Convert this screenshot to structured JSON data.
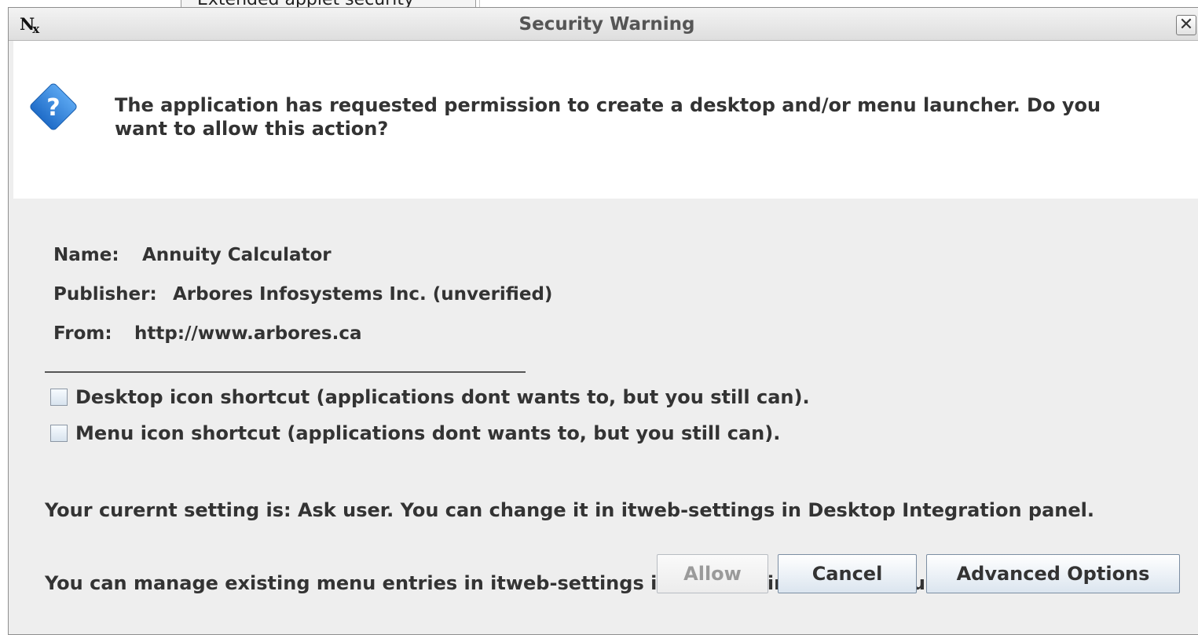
{
  "background": {
    "tab_text": "Extended applet security"
  },
  "window": {
    "logo_text": "N",
    "logo_sub": "x",
    "title": "Security Warning",
    "close_glyph": "✕"
  },
  "message": {
    "icon": "question-diamond-icon",
    "icon_glyph": "?",
    "icon_color": "#2e7fd8",
    "line1": "The application has requested permission to create a desktop and/or menu launcher. Do you",
    "line2": "want to allow this action?"
  },
  "info": {
    "name_label": "Name:",
    "name_value": "Annuity Calculator",
    "publisher_label": "Publisher:",
    "publisher_value": "Arbores Infosystems Inc. (unverified)",
    "from_label": "From:",
    "from_value": "http://www.arbores.ca"
  },
  "options": {
    "desktop_label": "Desktop icon shortcut (applications dont wants to, but you still can).",
    "menu_label": "Menu icon shortcut (applications dont wants to, but you still can).",
    "note_line1": "Your curernt setting is: Ask user. You can change it in itweb-settings in Desktop Integration panel.",
    "note_line2": "You can manage existing menu entries in itweb-settings in Manage installed menu shortcuts panel."
  },
  "buttons": {
    "allow": "Allow",
    "cancel": "Cancel",
    "advanced": "Advanced Options"
  }
}
